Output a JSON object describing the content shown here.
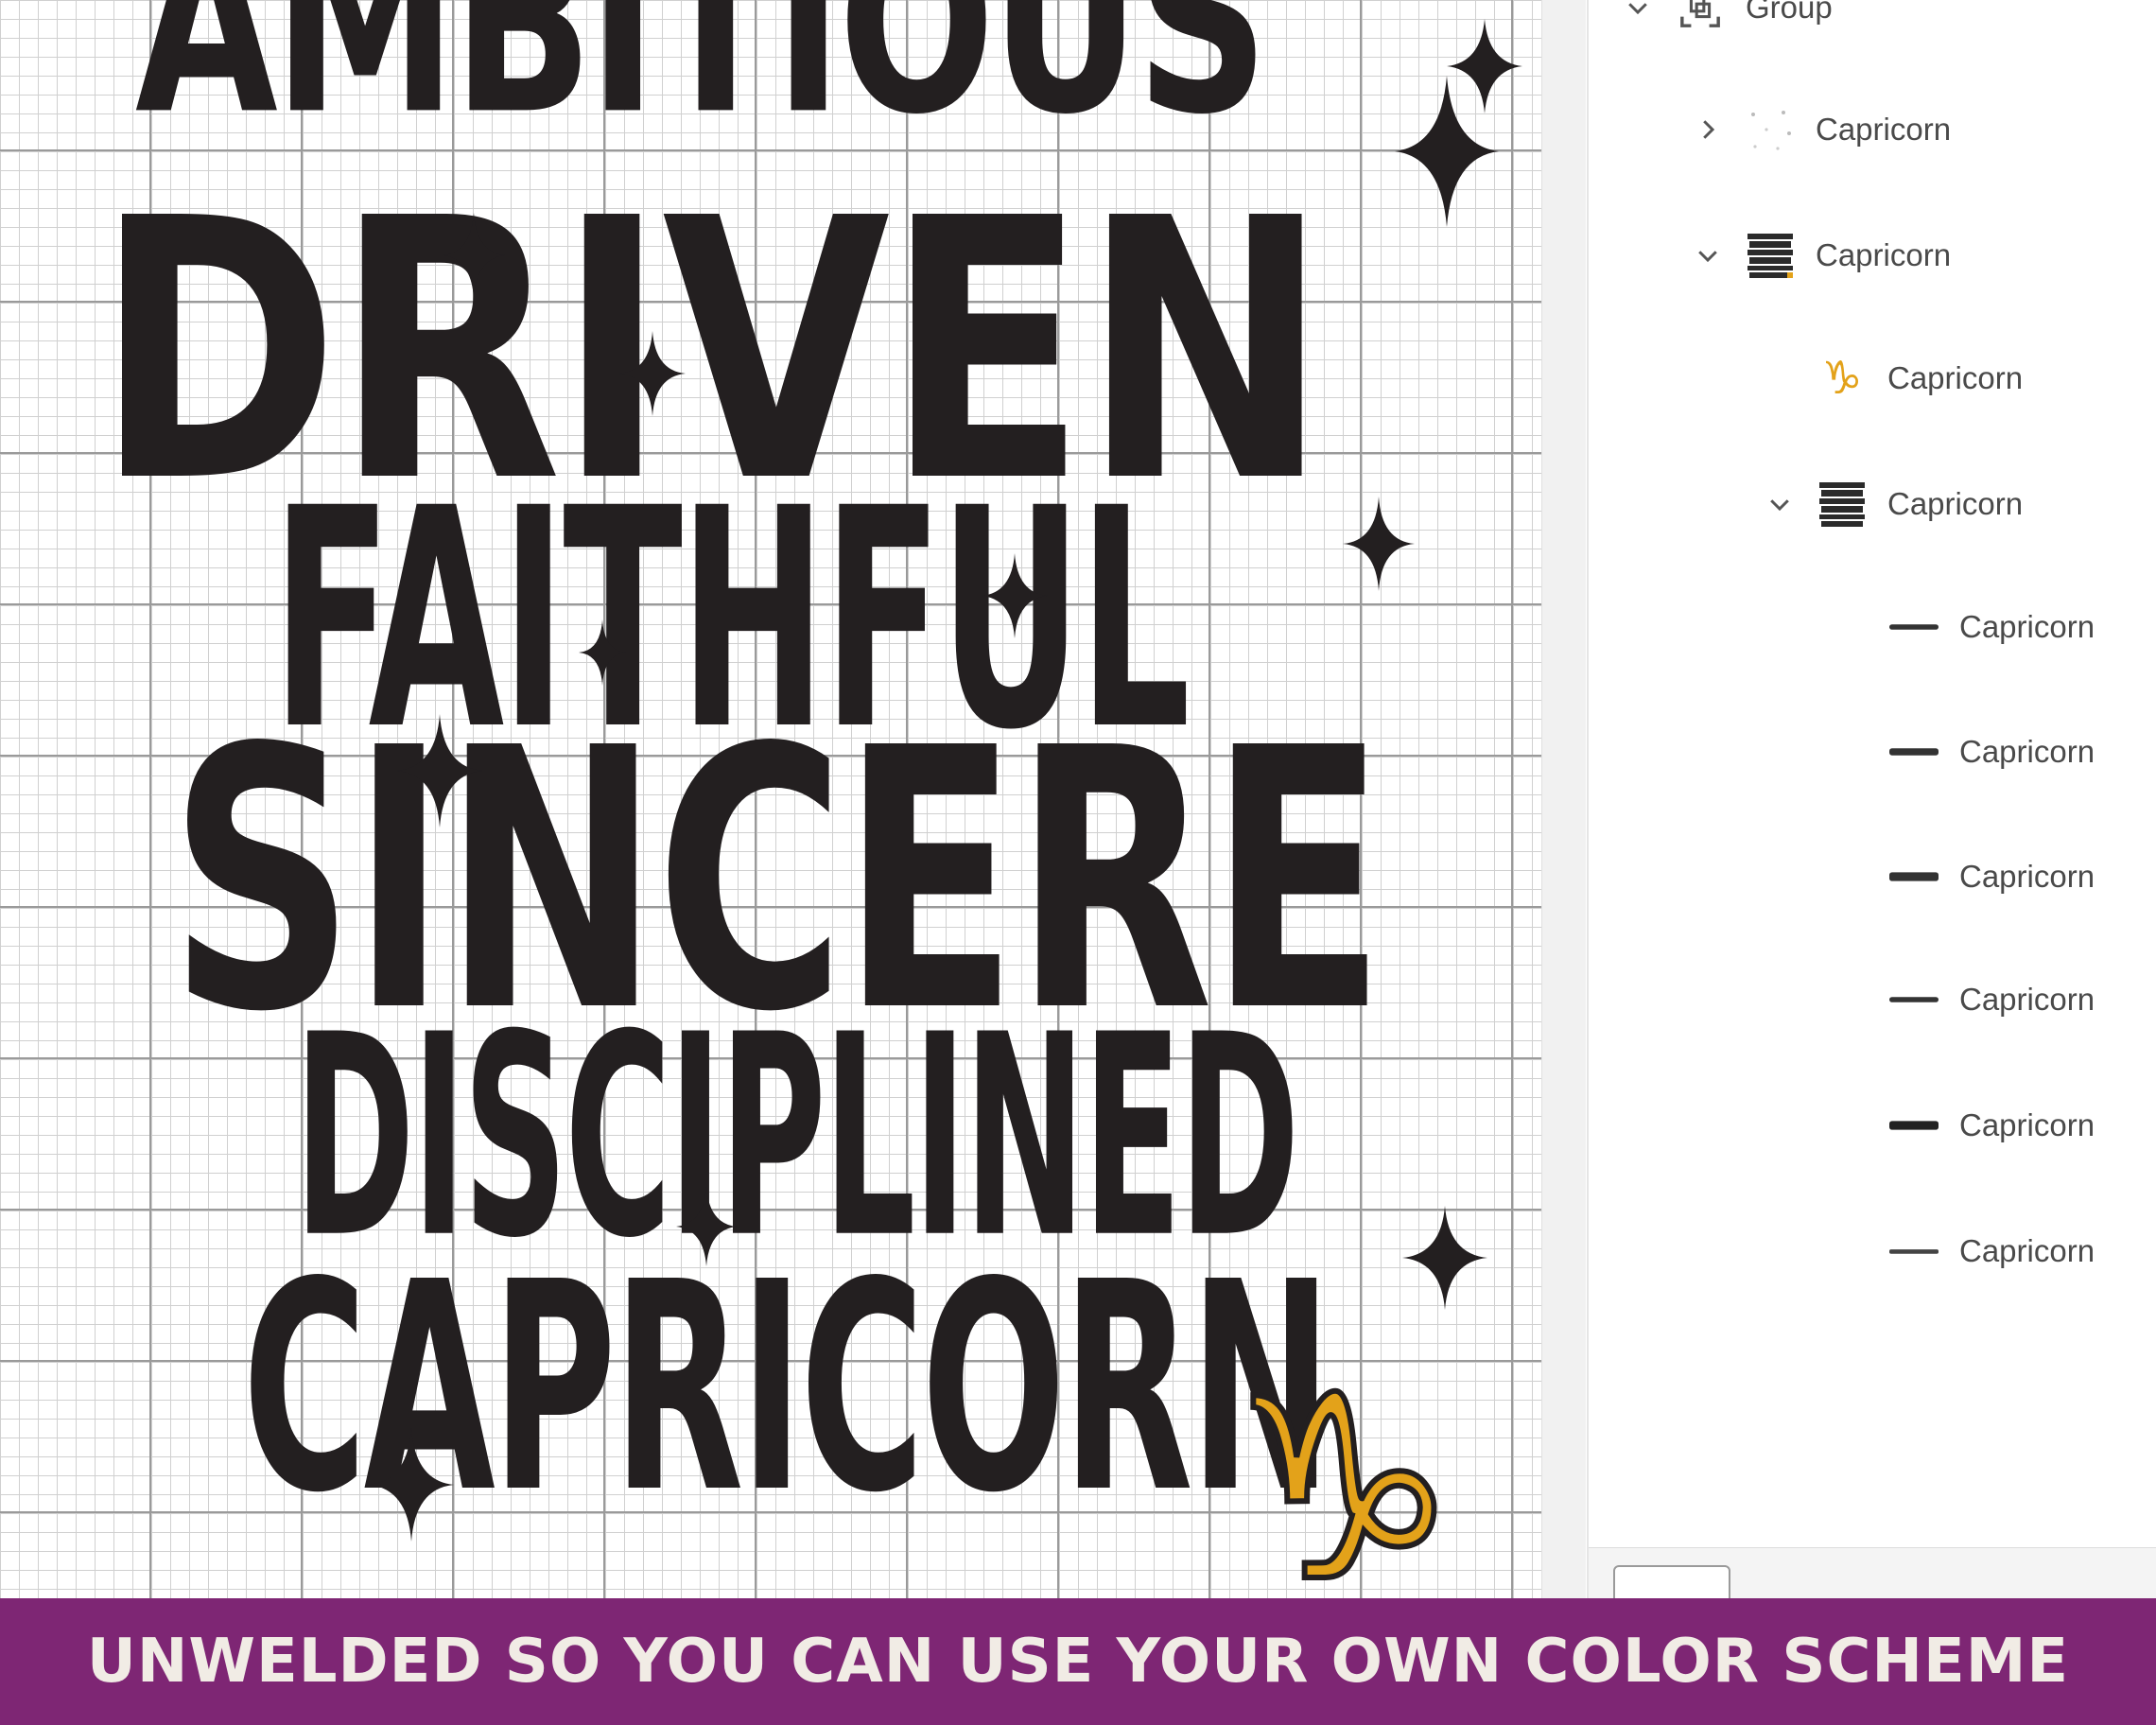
{
  "canvas": {
    "words": [
      "AMBITIOUS",
      "DRIVEN",
      "FAITHFUL",
      "SINCERE",
      "DISCIPLINED",
      "CAPRICORN"
    ],
    "ink_color": "#231f20",
    "symbol_color": "#e3a21a",
    "symbol": "♑"
  },
  "layers_panel": {
    "items": [
      {
        "label": "Group",
        "chevron": "down",
        "icon": "group-icon"
      },
      {
        "label": "Capricorn",
        "chevron": "right",
        "icon": "sparkles-thumbnail"
      },
      {
        "label": "Capricorn",
        "chevron": "down",
        "icon": "text-art-thumbnail"
      },
      {
        "label": "Capricorn",
        "chevron": "",
        "icon": "capricorn-symbol-thumbnail"
      },
      {
        "label": "Capricorn",
        "chevron": "down",
        "icon": "text-art-thumbnail"
      },
      {
        "label": "Capricorn",
        "chevron": "",
        "icon": "word-thumbnail"
      },
      {
        "label": "Capricorn",
        "chevron": "",
        "icon": "word-thumbnail"
      },
      {
        "label": "Capricorn",
        "chevron": "",
        "icon": "word-thumbnail"
      },
      {
        "label": "Capricorn",
        "chevron": "",
        "icon": "word-thumbnail"
      },
      {
        "label": "Capricorn",
        "chevron": "",
        "icon": "word-thumbnail"
      },
      {
        "label": "Capricorn",
        "chevron": "",
        "icon": "word-thumbnail"
      }
    ]
  },
  "banner": {
    "text": "UNWELDED SO YOU CAN USE YOUR OWN COLOR SCHEME",
    "background": "#7e2674"
  }
}
